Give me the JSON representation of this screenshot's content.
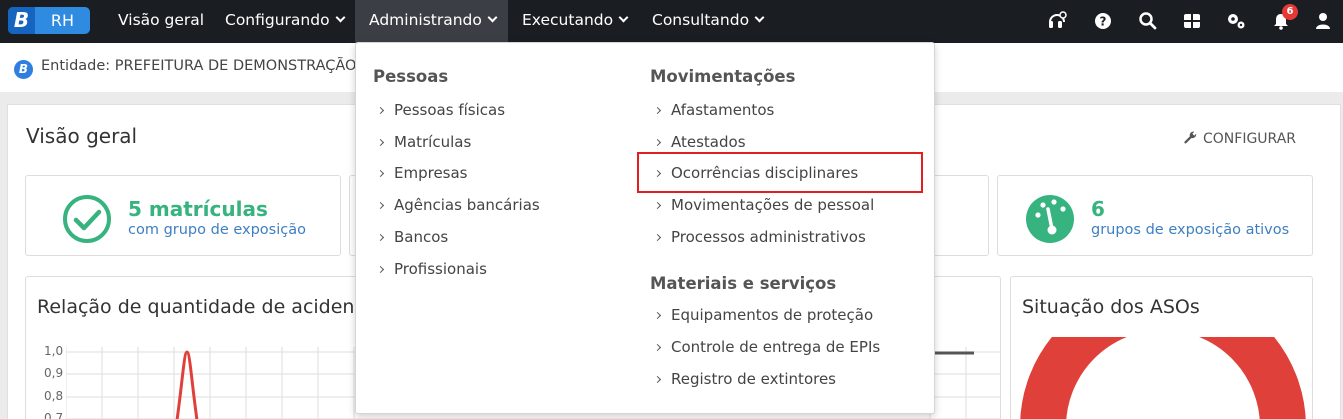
{
  "app": {
    "logo_letter": "B",
    "logo_name": "RH"
  },
  "nav": {
    "items": [
      {
        "label": "Visão geral"
      },
      {
        "label": "Configurando"
      },
      {
        "label": "Administrando"
      },
      {
        "label": "Executando"
      },
      {
        "label": "Consultando"
      }
    ],
    "notification_count": "6"
  },
  "entity": {
    "text": "Entidade: PREFEITURA DE DEMONSTRAÇÃO"
  },
  "overview": {
    "title": "Visão geral",
    "configure_label": "CONFIGURAR",
    "card_left": {
      "value": "5 matrículas",
      "subtitle": "com grupo de exposição"
    },
    "card_right": {
      "value": "6",
      "subtitle": "grupos de exposição ativos"
    },
    "chart_left_title": "Relação de quantidade de acidente",
    "chart_right_title": "Situação dos ASOs",
    "y_ticks": [
      "1,0",
      "0,9",
      "0,8",
      "0,7"
    ]
  },
  "dropdown": {
    "groups": [
      {
        "title": "Pessoas",
        "items": [
          "Pessoas físicas",
          "Matrículas",
          "Empresas",
          "Agências bancárias",
          "Bancos",
          "Profissionais"
        ]
      },
      {
        "title": "Movimentações",
        "items": [
          "Afastamentos",
          "Atestados",
          "Ocorrências disciplinares",
          "Movimentações de pessoal",
          "Processos administrativos"
        ]
      },
      {
        "title": "Materiais e serviços",
        "items": [
          "Equipamentos de proteção",
          "Controle de entrega de EPIs",
          "Registro de extintores"
        ]
      }
    ]
  },
  "colors": {
    "accent_green": "#36b37e",
    "link_blue": "#3e7fc1",
    "highlight_red": "#e02020",
    "donut_red": "#e0403a"
  }
}
